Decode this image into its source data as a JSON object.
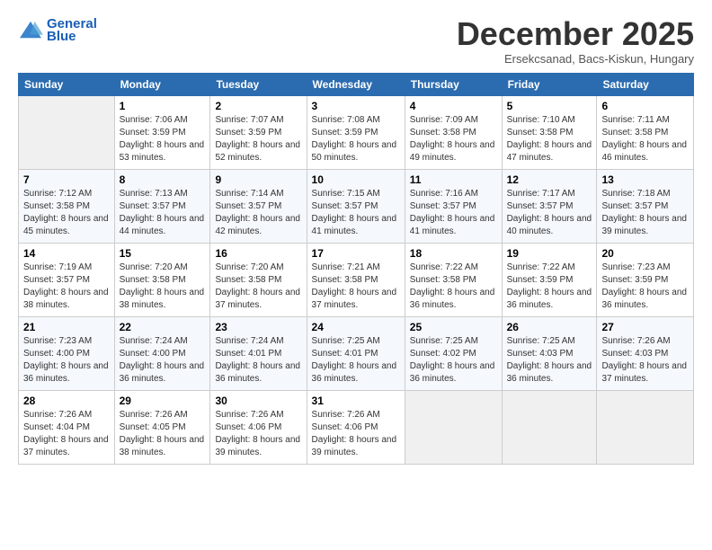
{
  "logo": {
    "line1": "General",
    "line2": "Blue"
  },
  "title": "December 2025",
  "subtitle": "Ersekcsanad, Bacs-Kiskun, Hungary",
  "weekdays": [
    "Sunday",
    "Monday",
    "Tuesday",
    "Wednesday",
    "Thursday",
    "Friday",
    "Saturday"
  ],
  "weeks": [
    [
      {
        "day": "",
        "sunrise": "",
        "sunset": "",
        "daylight": ""
      },
      {
        "day": "1",
        "sunrise": "Sunrise: 7:06 AM",
        "sunset": "Sunset: 3:59 PM",
        "daylight": "Daylight: 8 hours and 53 minutes."
      },
      {
        "day": "2",
        "sunrise": "Sunrise: 7:07 AM",
        "sunset": "Sunset: 3:59 PM",
        "daylight": "Daylight: 8 hours and 52 minutes."
      },
      {
        "day": "3",
        "sunrise": "Sunrise: 7:08 AM",
        "sunset": "Sunset: 3:59 PM",
        "daylight": "Daylight: 8 hours and 50 minutes."
      },
      {
        "day": "4",
        "sunrise": "Sunrise: 7:09 AM",
        "sunset": "Sunset: 3:58 PM",
        "daylight": "Daylight: 8 hours and 49 minutes."
      },
      {
        "day": "5",
        "sunrise": "Sunrise: 7:10 AM",
        "sunset": "Sunset: 3:58 PM",
        "daylight": "Daylight: 8 hours and 47 minutes."
      },
      {
        "day": "6",
        "sunrise": "Sunrise: 7:11 AM",
        "sunset": "Sunset: 3:58 PM",
        "daylight": "Daylight: 8 hours and 46 minutes."
      }
    ],
    [
      {
        "day": "7",
        "sunrise": "Sunrise: 7:12 AM",
        "sunset": "Sunset: 3:58 PM",
        "daylight": "Daylight: 8 hours and 45 minutes."
      },
      {
        "day": "8",
        "sunrise": "Sunrise: 7:13 AM",
        "sunset": "Sunset: 3:57 PM",
        "daylight": "Daylight: 8 hours and 44 minutes."
      },
      {
        "day": "9",
        "sunrise": "Sunrise: 7:14 AM",
        "sunset": "Sunset: 3:57 PM",
        "daylight": "Daylight: 8 hours and 42 minutes."
      },
      {
        "day": "10",
        "sunrise": "Sunrise: 7:15 AM",
        "sunset": "Sunset: 3:57 PM",
        "daylight": "Daylight: 8 hours and 41 minutes."
      },
      {
        "day": "11",
        "sunrise": "Sunrise: 7:16 AM",
        "sunset": "Sunset: 3:57 PM",
        "daylight": "Daylight: 8 hours and 41 minutes."
      },
      {
        "day": "12",
        "sunrise": "Sunrise: 7:17 AM",
        "sunset": "Sunset: 3:57 PM",
        "daylight": "Daylight: 8 hours and 40 minutes."
      },
      {
        "day": "13",
        "sunrise": "Sunrise: 7:18 AM",
        "sunset": "Sunset: 3:57 PM",
        "daylight": "Daylight: 8 hours and 39 minutes."
      }
    ],
    [
      {
        "day": "14",
        "sunrise": "Sunrise: 7:19 AM",
        "sunset": "Sunset: 3:57 PM",
        "daylight": "Daylight: 8 hours and 38 minutes."
      },
      {
        "day": "15",
        "sunrise": "Sunrise: 7:20 AM",
        "sunset": "Sunset: 3:58 PM",
        "daylight": "Daylight: 8 hours and 38 minutes."
      },
      {
        "day": "16",
        "sunrise": "Sunrise: 7:20 AM",
        "sunset": "Sunset: 3:58 PM",
        "daylight": "Daylight: 8 hours and 37 minutes."
      },
      {
        "day": "17",
        "sunrise": "Sunrise: 7:21 AM",
        "sunset": "Sunset: 3:58 PM",
        "daylight": "Daylight: 8 hours and 37 minutes."
      },
      {
        "day": "18",
        "sunrise": "Sunrise: 7:22 AM",
        "sunset": "Sunset: 3:58 PM",
        "daylight": "Daylight: 8 hours and 36 minutes."
      },
      {
        "day": "19",
        "sunrise": "Sunrise: 7:22 AM",
        "sunset": "Sunset: 3:59 PM",
        "daylight": "Daylight: 8 hours and 36 minutes."
      },
      {
        "day": "20",
        "sunrise": "Sunrise: 7:23 AM",
        "sunset": "Sunset: 3:59 PM",
        "daylight": "Daylight: 8 hours and 36 minutes."
      }
    ],
    [
      {
        "day": "21",
        "sunrise": "Sunrise: 7:23 AM",
        "sunset": "Sunset: 4:00 PM",
        "daylight": "Daylight: 8 hours and 36 minutes."
      },
      {
        "day": "22",
        "sunrise": "Sunrise: 7:24 AM",
        "sunset": "Sunset: 4:00 PM",
        "daylight": "Daylight: 8 hours and 36 minutes."
      },
      {
        "day": "23",
        "sunrise": "Sunrise: 7:24 AM",
        "sunset": "Sunset: 4:01 PM",
        "daylight": "Daylight: 8 hours and 36 minutes."
      },
      {
        "day": "24",
        "sunrise": "Sunrise: 7:25 AM",
        "sunset": "Sunset: 4:01 PM",
        "daylight": "Daylight: 8 hours and 36 minutes."
      },
      {
        "day": "25",
        "sunrise": "Sunrise: 7:25 AM",
        "sunset": "Sunset: 4:02 PM",
        "daylight": "Daylight: 8 hours and 36 minutes."
      },
      {
        "day": "26",
        "sunrise": "Sunrise: 7:25 AM",
        "sunset": "Sunset: 4:03 PM",
        "daylight": "Daylight: 8 hours and 36 minutes."
      },
      {
        "day": "27",
        "sunrise": "Sunrise: 7:26 AM",
        "sunset": "Sunset: 4:03 PM",
        "daylight": "Daylight: 8 hours and 37 minutes."
      }
    ],
    [
      {
        "day": "28",
        "sunrise": "Sunrise: 7:26 AM",
        "sunset": "Sunset: 4:04 PM",
        "daylight": "Daylight: 8 hours and 37 minutes."
      },
      {
        "day": "29",
        "sunrise": "Sunrise: 7:26 AM",
        "sunset": "Sunset: 4:05 PM",
        "daylight": "Daylight: 8 hours and 38 minutes."
      },
      {
        "day": "30",
        "sunrise": "Sunrise: 7:26 AM",
        "sunset": "Sunset: 4:06 PM",
        "daylight": "Daylight: 8 hours and 39 minutes."
      },
      {
        "day": "31",
        "sunrise": "Sunrise: 7:26 AM",
        "sunset": "Sunset: 4:06 PM",
        "daylight": "Daylight: 8 hours and 39 minutes."
      },
      {
        "day": "",
        "sunrise": "",
        "sunset": "",
        "daylight": ""
      },
      {
        "day": "",
        "sunrise": "",
        "sunset": "",
        "daylight": ""
      },
      {
        "day": "",
        "sunrise": "",
        "sunset": "",
        "daylight": ""
      }
    ]
  ]
}
